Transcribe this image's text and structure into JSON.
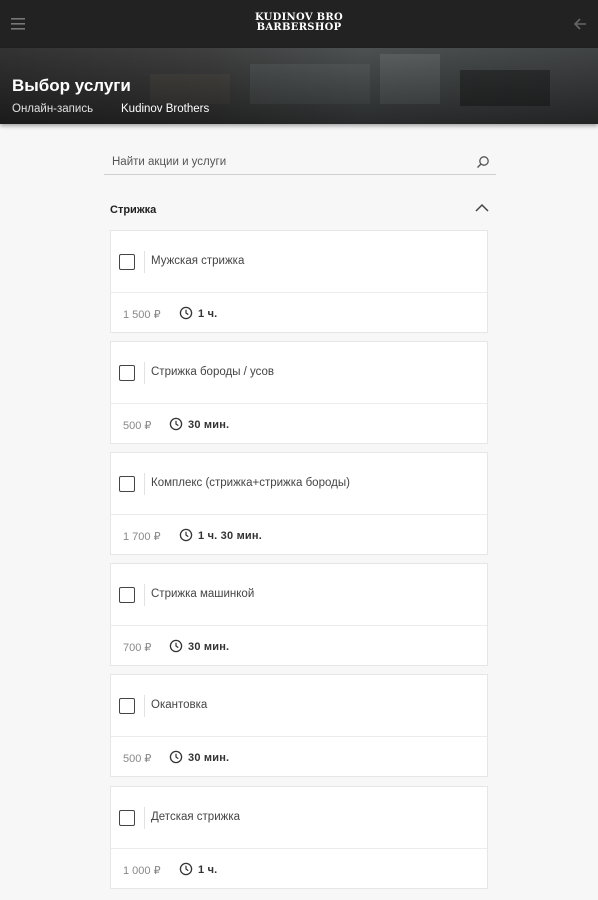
{
  "header": {
    "logo_line1": "KUDINOV BRO",
    "logo_line2": "BARBERSHOP",
    "menu_icon": "menu-icon",
    "back_icon": "arrow-left-icon"
  },
  "hero": {
    "title": "Выбор услуги",
    "breadcrumb": [
      "Онлайн-запись",
      "Kudinov Brothers"
    ]
  },
  "search": {
    "placeholder": "Найти акции и услуги",
    "value": ""
  },
  "section": {
    "title": "Стрижка",
    "expanded": true
  },
  "services": [
    {
      "name": "Мужская стрижка",
      "price": "1 500 ₽",
      "duration": "1 ч."
    },
    {
      "name": "Стрижка бороды / усов",
      "price": "500 ₽",
      "duration": "30  мин."
    },
    {
      "name": "Комплекс (стрижка+стрижка бороды)",
      "price": "1 700 ₽",
      "duration": "1 ч.  30  мин."
    },
    {
      "name": "Стрижка машинкой",
      "price": "700 ₽",
      "duration": "30  мин."
    },
    {
      "name": "Окантовка",
      "price": "500 ₽",
      "duration": "30  мин."
    },
    {
      "name": "Детская стрижка",
      "price": "1 000 ₽",
      "duration": "1 ч."
    }
  ],
  "colors": {
    "topbar": "#222222",
    "background": "#f7f7f7",
    "card": "#ffffff"
  }
}
